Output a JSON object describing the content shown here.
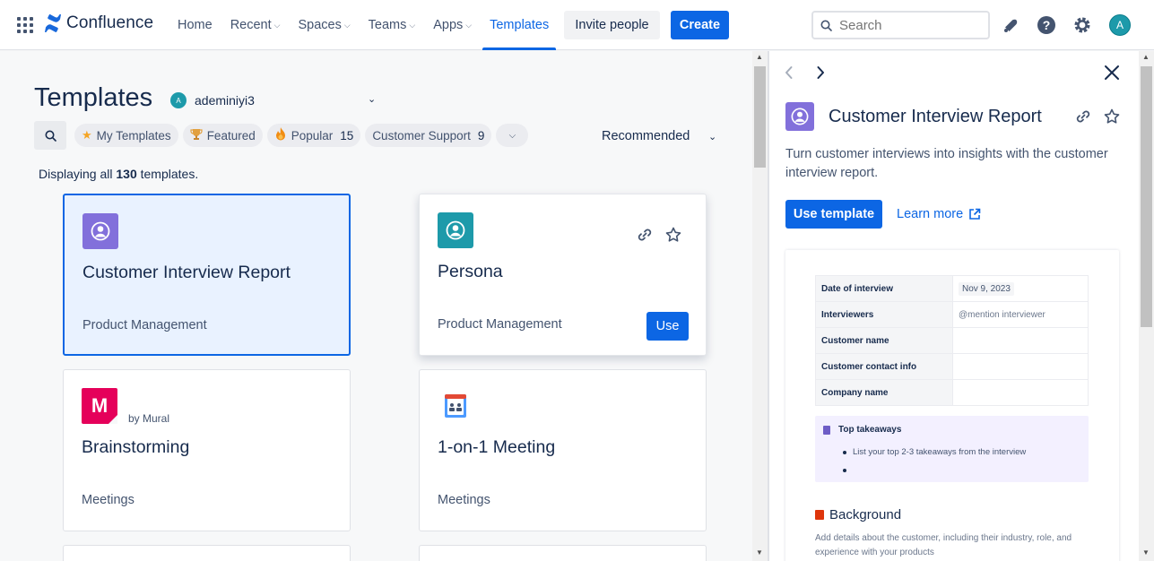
{
  "app": {
    "name": "Confluence"
  },
  "nav": {
    "links": [
      {
        "label": "Home",
        "dropdown": false
      },
      {
        "label": "Recent",
        "dropdown": true
      },
      {
        "label": "Spaces",
        "dropdown": true
      },
      {
        "label": "Teams",
        "dropdown": true
      },
      {
        "label": "Apps",
        "dropdown": true
      },
      {
        "label": "Templates",
        "dropdown": false,
        "active": true
      }
    ],
    "invite_label": "Invite people",
    "create_label": "Create",
    "search_placeholder": "Search",
    "avatar_initial": "A"
  },
  "main": {
    "title": "Templates",
    "user": {
      "initial": "A",
      "name": "ademiniyi3"
    },
    "filters": [
      {
        "label": "My Templates",
        "icon": "star-icon",
        "count": ""
      },
      {
        "label": "Featured",
        "icon": "trophy-icon",
        "count": ""
      },
      {
        "label": "Popular",
        "icon": "flame-icon",
        "count": "15"
      },
      {
        "label": "Customer Support",
        "icon": "",
        "count": "9"
      }
    ],
    "sort_label": "Recommended",
    "displaying_prefix": "Displaying all",
    "displaying_count": "130",
    "displaying_suffix": "templates.",
    "cards": [
      {
        "title": "Customer Interview Report",
        "category": "Product Management",
        "tile_color": "#8270db",
        "icon": "person-icon",
        "state": "selected"
      },
      {
        "title": "Persona",
        "category": "Product Management",
        "tile_color": "#1d9aaa",
        "icon": "person-icon",
        "state": "hover",
        "use_label": "Use"
      },
      {
        "title": "Brainstorming",
        "category": "Meetings",
        "tile_color": "#e5005a",
        "icon": "mural-icon",
        "tile_letter": "M",
        "by": "by Mural"
      },
      {
        "title": "1-on-1 Meeting",
        "category": "Meetings",
        "tile_color": "#ffffff",
        "icon": "meeting-icon"
      }
    ]
  },
  "panel": {
    "title": "Customer Interview Report",
    "description": "Turn customer interviews into insights with the customer interview report.",
    "use_label": "Use template",
    "learn_label": "Learn more",
    "preview": {
      "rows": [
        {
          "key": "Date of interview",
          "value": "Nov 9, 2023",
          "is_date": true
        },
        {
          "key": "Interviewers",
          "value": "@mention interviewer"
        },
        {
          "key": "Customer name",
          "value": ""
        },
        {
          "key": "Customer contact info",
          "value": ""
        },
        {
          "key": "Company name",
          "value": ""
        }
      ],
      "takeaways_title": "Top takeaways",
      "takeaways_items": [
        "List your top 2-3 takeaways from the interview",
        ""
      ],
      "background_title": "Background",
      "background_desc": "Add details about the customer, including their industry, role, and experience with your products"
    }
  },
  "colors": {
    "primary": "#0c66e4",
    "text": "#172b4d",
    "subtle": "#44546f",
    "selected_bg": "#e9f2ff"
  }
}
